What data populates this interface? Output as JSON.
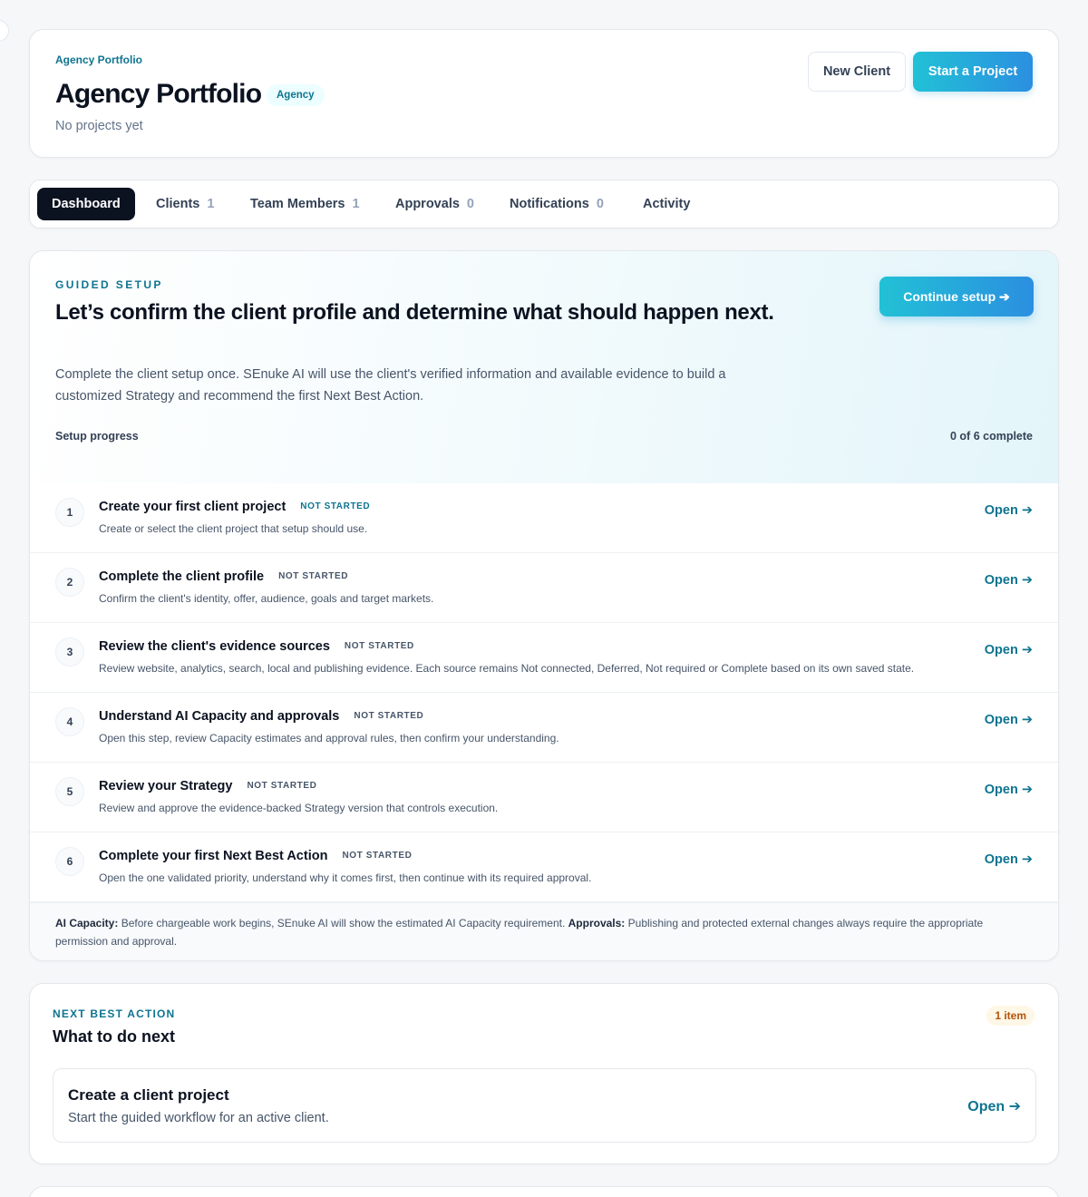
{
  "header": {
    "eyebrow": "Agency Portfolio",
    "title": "Agency Portfolio",
    "badge": "Agency",
    "subtitle": "No projects yet",
    "new_client_label": "New Client",
    "start_project_label": "Start a Project"
  },
  "tabs": [
    {
      "label": "Dashboard",
      "count": ""
    },
    {
      "label": "Clients",
      "count": "1"
    },
    {
      "label": "Team Members",
      "count": "1"
    },
    {
      "label": "Approvals",
      "count": "0"
    },
    {
      "label": "Notifications",
      "count": "0"
    },
    {
      "label": "Activity",
      "count": ""
    }
  ],
  "setup": {
    "eyebrow": "GUIDED SETUP",
    "title": "Let’s confirm the client profile and determine what should happen next.",
    "description": "Complete the client setup once. SEnuke AI will use the client's verified information and available evidence to build a customized Strategy and recommend the first Next Best Action.",
    "continue_label": "Continue setup ➔",
    "progress_label": "Setup progress",
    "progress_count": "0 of 6 complete",
    "steps": [
      {
        "num": "1",
        "title": "Create your first client project",
        "status": "NOT STARTED",
        "desc": "Create or select the client project that setup should use.",
        "link": "Open ➔"
      },
      {
        "num": "2",
        "title": "Complete the client profile",
        "status": "NOT STARTED",
        "desc": "Confirm the client's identity, offer, audience, goals and target markets.",
        "link": "Open ➔"
      },
      {
        "num": "3",
        "title": "Review the client's evidence sources",
        "status": "NOT STARTED",
        "desc": "Review website, analytics, search, local and publishing evidence. Each source remains Not connected, Deferred, Not required or Complete based on its own saved state.",
        "link": "Open ➔"
      },
      {
        "num": "4",
        "title": "Understand AI Capacity and approvals",
        "status": "NOT STARTED",
        "desc": "Open this step, review Capacity estimates and approval rules, then confirm your understanding.",
        "link": "Open ➔"
      },
      {
        "num": "5",
        "title": "Review your Strategy",
        "status": "NOT STARTED",
        "desc": "Review and approve the evidence-backed Strategy version that controls execution.",
        "link": "Open ➔"
      },
      {
        "num": "6",
        "title": "Complete your first Next Best Action",
        "status": "NOT STARTED",
        "desc": "Open the one validated priority, understand why it comes first, then continue with its required approval.",
        "link": "Open ➔"
      }
    ],
    "footer": {
      "capacity_label": "AI Capacity:",
      "capacity_text": " Before chargeable work begins, SEnuke AI will show the estimated AI Capacity requirement. ",
      "approvals_label": "Approvals:",
      "approvals_text": " Publishing and protected external changes always require the appropriate permission and approval."
    }
  },
  "next_best_action": {
    "eyebrow": "NEXT BEST ACTION",
    "title": "What to do next",
    "badge": "1 item",
    "item": {
      "title": "Create a client project",
      "desc": "Start the guided workflow for an active client.",
      "link": "Open ➔"
    }
  }
}
